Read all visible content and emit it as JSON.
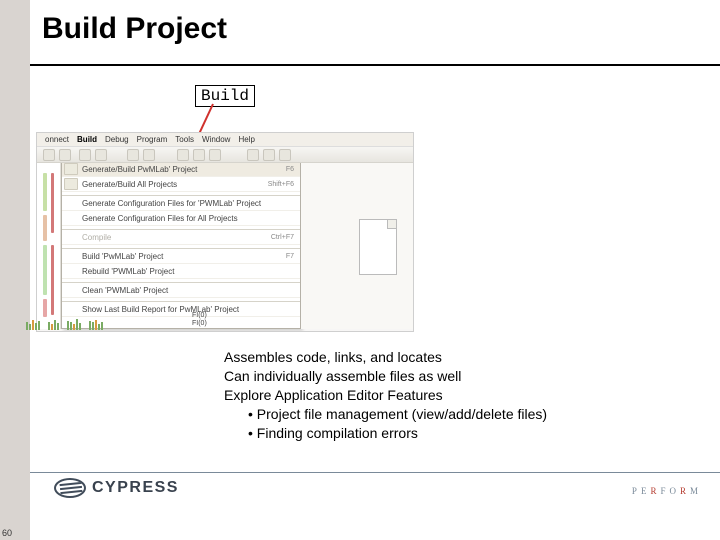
{
  "slide": {
    "title": "Build Project",
    "number": "60"
  },
  "callout": {
    "label": "Build"
  },
  "ide": {
    "menubar": [
      "onnect",
      "Build",
      "Debug",
      "Program",
      "Tools",
      "Window",
      "Help"
    ],
    "menu_items": [
      {
        "label": "Generate/Build PwMLab' Project",
        "shortcut": "F6",
        "highlight": true
      },
      {
        "label": "Generate/Build All Projects",
        "shortcut": "Shift+F6"
      },
      {
        "label": "Generate Configuration Files for 'PWMLab' Project",
        "shortcut": ""
      },
      {
        "label": "Generate Configuration Files for All Projects",
        "shortcut": ""
      },
      {
        "label": "Compile",
        "shortcut": "Ctrl+F7",
        "disabled": true
      },
      {
        "label": "Build 'PwMLab' Project",
        "shortcut": "F7"
      },
      {
        "label": "Rebuild 'PWMLab' Project",
        "shortcut": ""
      },
      {
        "label": "Clean 'PWMLab' Project",
        "shortcut": ""
      },
      {
        "label": "Show Last Build Report for PwMLab' Project",
        "shortcut": ""
      }
    ],
    "foot_labels": [
      "FI(0)",
      "FI(0)"
    ]
  },
  "body": {
    "l1": "Assembles code, links, and locates",
    "l2": "Can individually assemble files as well",
    "l3": "Explore Application Editor Features",
    "b1": "Project file management (view/add/delete files)",
    "b2": "Finding compilation errors"
  },
  "brand": {
    "name": "CYPRESS"
  },
  "perform": {
    "p": "P",
    "e": "E",
    "r": "R",
    "f": "F",
    "o": "O",
    "m": "M"
  }
}
